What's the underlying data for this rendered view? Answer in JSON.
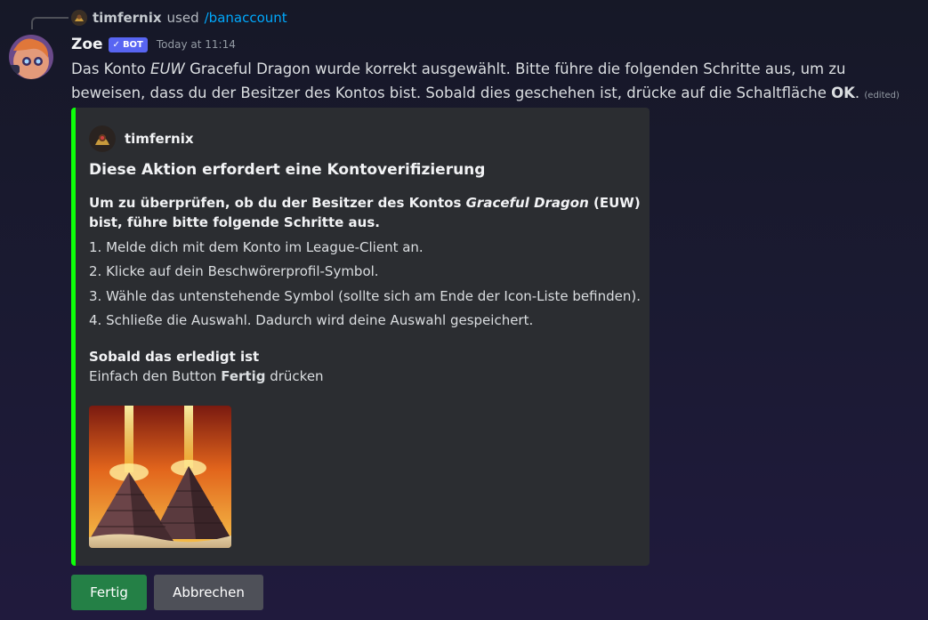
{
  "reply": {
    "user": "timfernix",
    "used": "used",
    "command": "/banaccount"
  },
  "message": {
    "author": "Zoe",
    "bot_badge": "BOT",
    "timestamp": "Today at 11:14",
    "text_1": "Das Konto ",
    "text_region": "EUW",
    "text_2": " Graceful Dragon wurde korrekt ausgewählt. Bitte führe die folgenden Schritte aus, um zu beweisen, dass du der Besitzer des Kontos bist. Sobald dies geschehen ist, drücke auf die Schaltfläche ",
    "text_ok": "OK",
    "text_3": ".",
    "edited": "(edited)"
  },
  "embed": {
    "accent_color": "#0eff0a",
    "author": "timfernix",
    "title": "Diese Aktion erfordert eine Kontoverifizierung",
    "intro_1": "Um zu überprüfen, ob du der Besitzer des Kontos ",
    "intro_account": "Graceful Dragon",
    "intro_2": " (EUW) bist, führe bitte folgende Schritte aus.",
    "steps": [
      "1. Melde dich mit dem Konto im League-Client an.",
      "2. Klicke auf dein Beschwörerprofil-Symbol.",
      "3. Wähle das untenstehende Symbol (sollte sich am Ende der Icon-Liste befinden).",
      "4. Schließe die Auswahl. Dadurch wird deine Auswahl gespeichert."
    ],
    "done_title": "Sobald das erledigt ist",
    "done_text_1": "Einfach den Button ",
    "done_text_bold": "Fertig",
    "done_text_2": " drücken"
  },
  "buttons": {
    "ok": "Fertig",
    "cancel": "Abbrechen"
  },
  "colors": {
    "ok_button": "#248046",
    "cancel_button": "#4e5058",
    "bot_badge": "#5865f2",
    "command_link": "#00a8fc"
  }
}
